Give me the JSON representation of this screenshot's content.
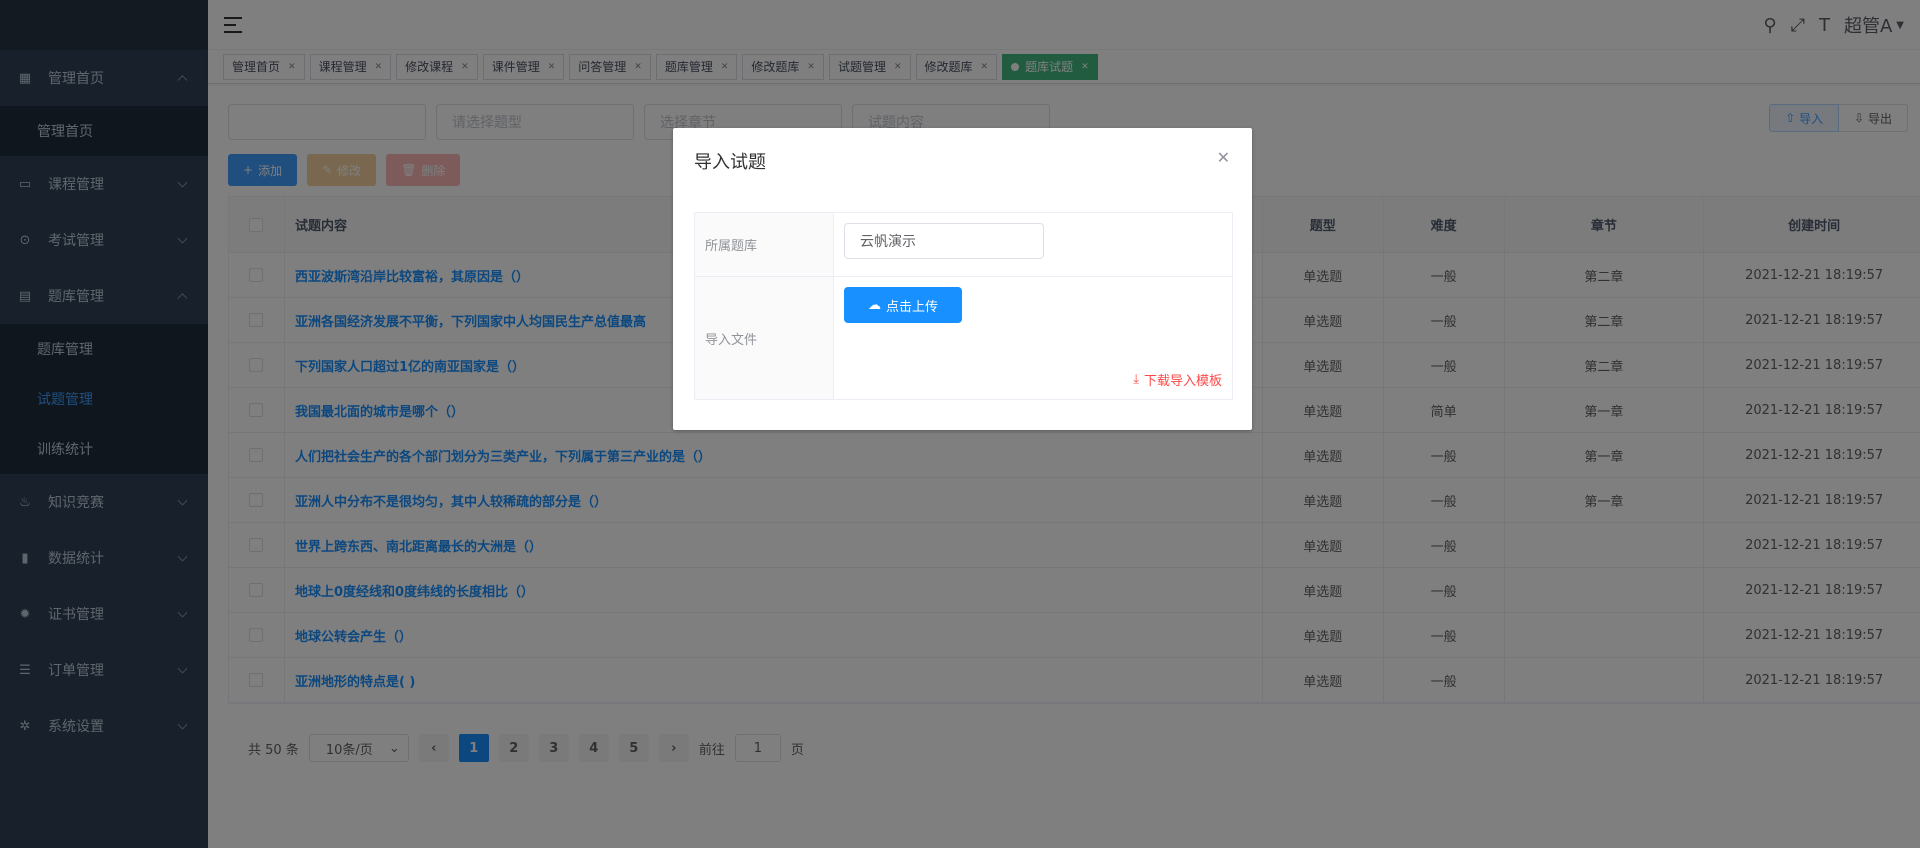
{
  "sidebar": {
    "items": [
      {
        "label": "管理首页",
        "icon": "dashboard-icon",
        "expanded": true,
        "children": [
          "管理首页"
        ]
      },
      {
        "label": "课程管理",
        "icon": "monitor-icon",
        "expanded": false
      },
      {
        "label": "考试管理",
        "icon": "circle-gear-icon",
        "expanded": false
      },
      {
        "label": "题库管理",
        "icon": "document-icon",
        "expanded": true,
        "children": [
          "题库管理",
          "试题管理",
          "训练统计"
        ],
        "active_child": "试题管理"
      },
      {
        "label": "知识竞赛",
        "icon": "fire-icon",
        "expanded": false
      },
      {
        "label": "数据统计",
        "icon": "bar-chart-icon",
        "expanded": false
      },
      {
        "label": "证书管理",
        "icon": "gear-icon",
        "expanded": false
      },
      {
        "label": "订单管理",
        "icon": "list-icon",
        "expanded": false
      },
      {
        "label": "系统设置",
        "icon": "settings-icon",
        "expanded": false
      }
    ]
  },
  "navbar": {
    "user": "超管A"
  },
  "tags": [
    "管理首页",
    "课程管理",
    "修改课程",
    "课件管理",
    "问答管理",
    "题库管理",
    "修改题库",
    "试题管理",
    "修改题库",
    "题库试题"
  ],
  "search": {
    "p1": "",
    "p2": "请选择题型",
    "p3": "选择章节",
    "p4": "试题内容"
  },
  "io": {
    "import": "导入",
    "export": "导出"
  },
  "actions": {
    "add": "添加",
    "edit": "修改",
    "delete": "删除"
  },
  "table": {
    "headers": [
      "试题内容",
      "题型",
      "难度",
      "章节",
      "创建时间"
    ],
    "rows": [
      [
        "西亚波斯湾沿岸比较富裕，其原因是（）",
        "单选题",
        "一般",
        "第二章",
        "2021-12-21 18:19:57"
      ],
      [
        "亚洲各国经济发展不平衡，下列国家中人均国民生产总值最高",
        "单选题",
        "一般",
        "第二章",
        "2021-12-21 18:19:57"
      ],
      [
        "下列国家人口超过1亿的南亚国家是（）",
        "单选题",
        "一般",
        "第二章",
        "2021-12-21 18:19:57"
      ],
      [
        "我国最北面的城市是哪个（）",
        "单选题",
        "简单",
        "第一章",
        "2021-12-21 18:19:57"
      ],
      [
        "人们把社会生产的各个部门划分为三类产业，下列属于第三产业的是（）",
        "单选题",
        "一般",
        "第一章",
        "2021-12-21 18:19:57"
      ],
      [
        "亚洲人中分布不是很均匀，其中人较稀疏的部分是（）",
        "单选题",
        "一般",
        "第一章",
        "2021-12-21 18:19:57"
      ],
      [
        "世界上跨东西、南北距离最长的大洲是（）",
        "单选题",
        "一般",
        "",
        "2021-12-21 18:19:57"
      ],
      [
        "地球上0度经线和0度纬线的长度相比（）",
        "单选题",
        "一般",
        "",
        "2021-12-21 18:19:57"
      ],
      [
        "地球公转会产生（）",
        "单选题",
        "一般",
        "",
        "2021-12-21 18:19:57"
      ],
      [
        "亚洲地形的特点是( )",
        "单选题",
        "一般",
        "",
        "2021-12-21 18:19:57"
      ]
    ]
  },
  "pagination": {
    "total": "共 50 条",
    "size": "10条/页",
    "pages": [
      "1",
      "2",
      "3",
      "4",
      "5"
    ],
    "current": "1",
    "goto": "前往",
    "goto_value": "1",
    "goto_suffix": "页"
  },
  "dialog": {
    "title": "导入试题",
    "lib_label": "所属题库",
    "lib_value": "云帆演示",
    "file_label": "导入文件",
    "upload": "点击上传",
    "template": "下载导入模板"
  }
}
